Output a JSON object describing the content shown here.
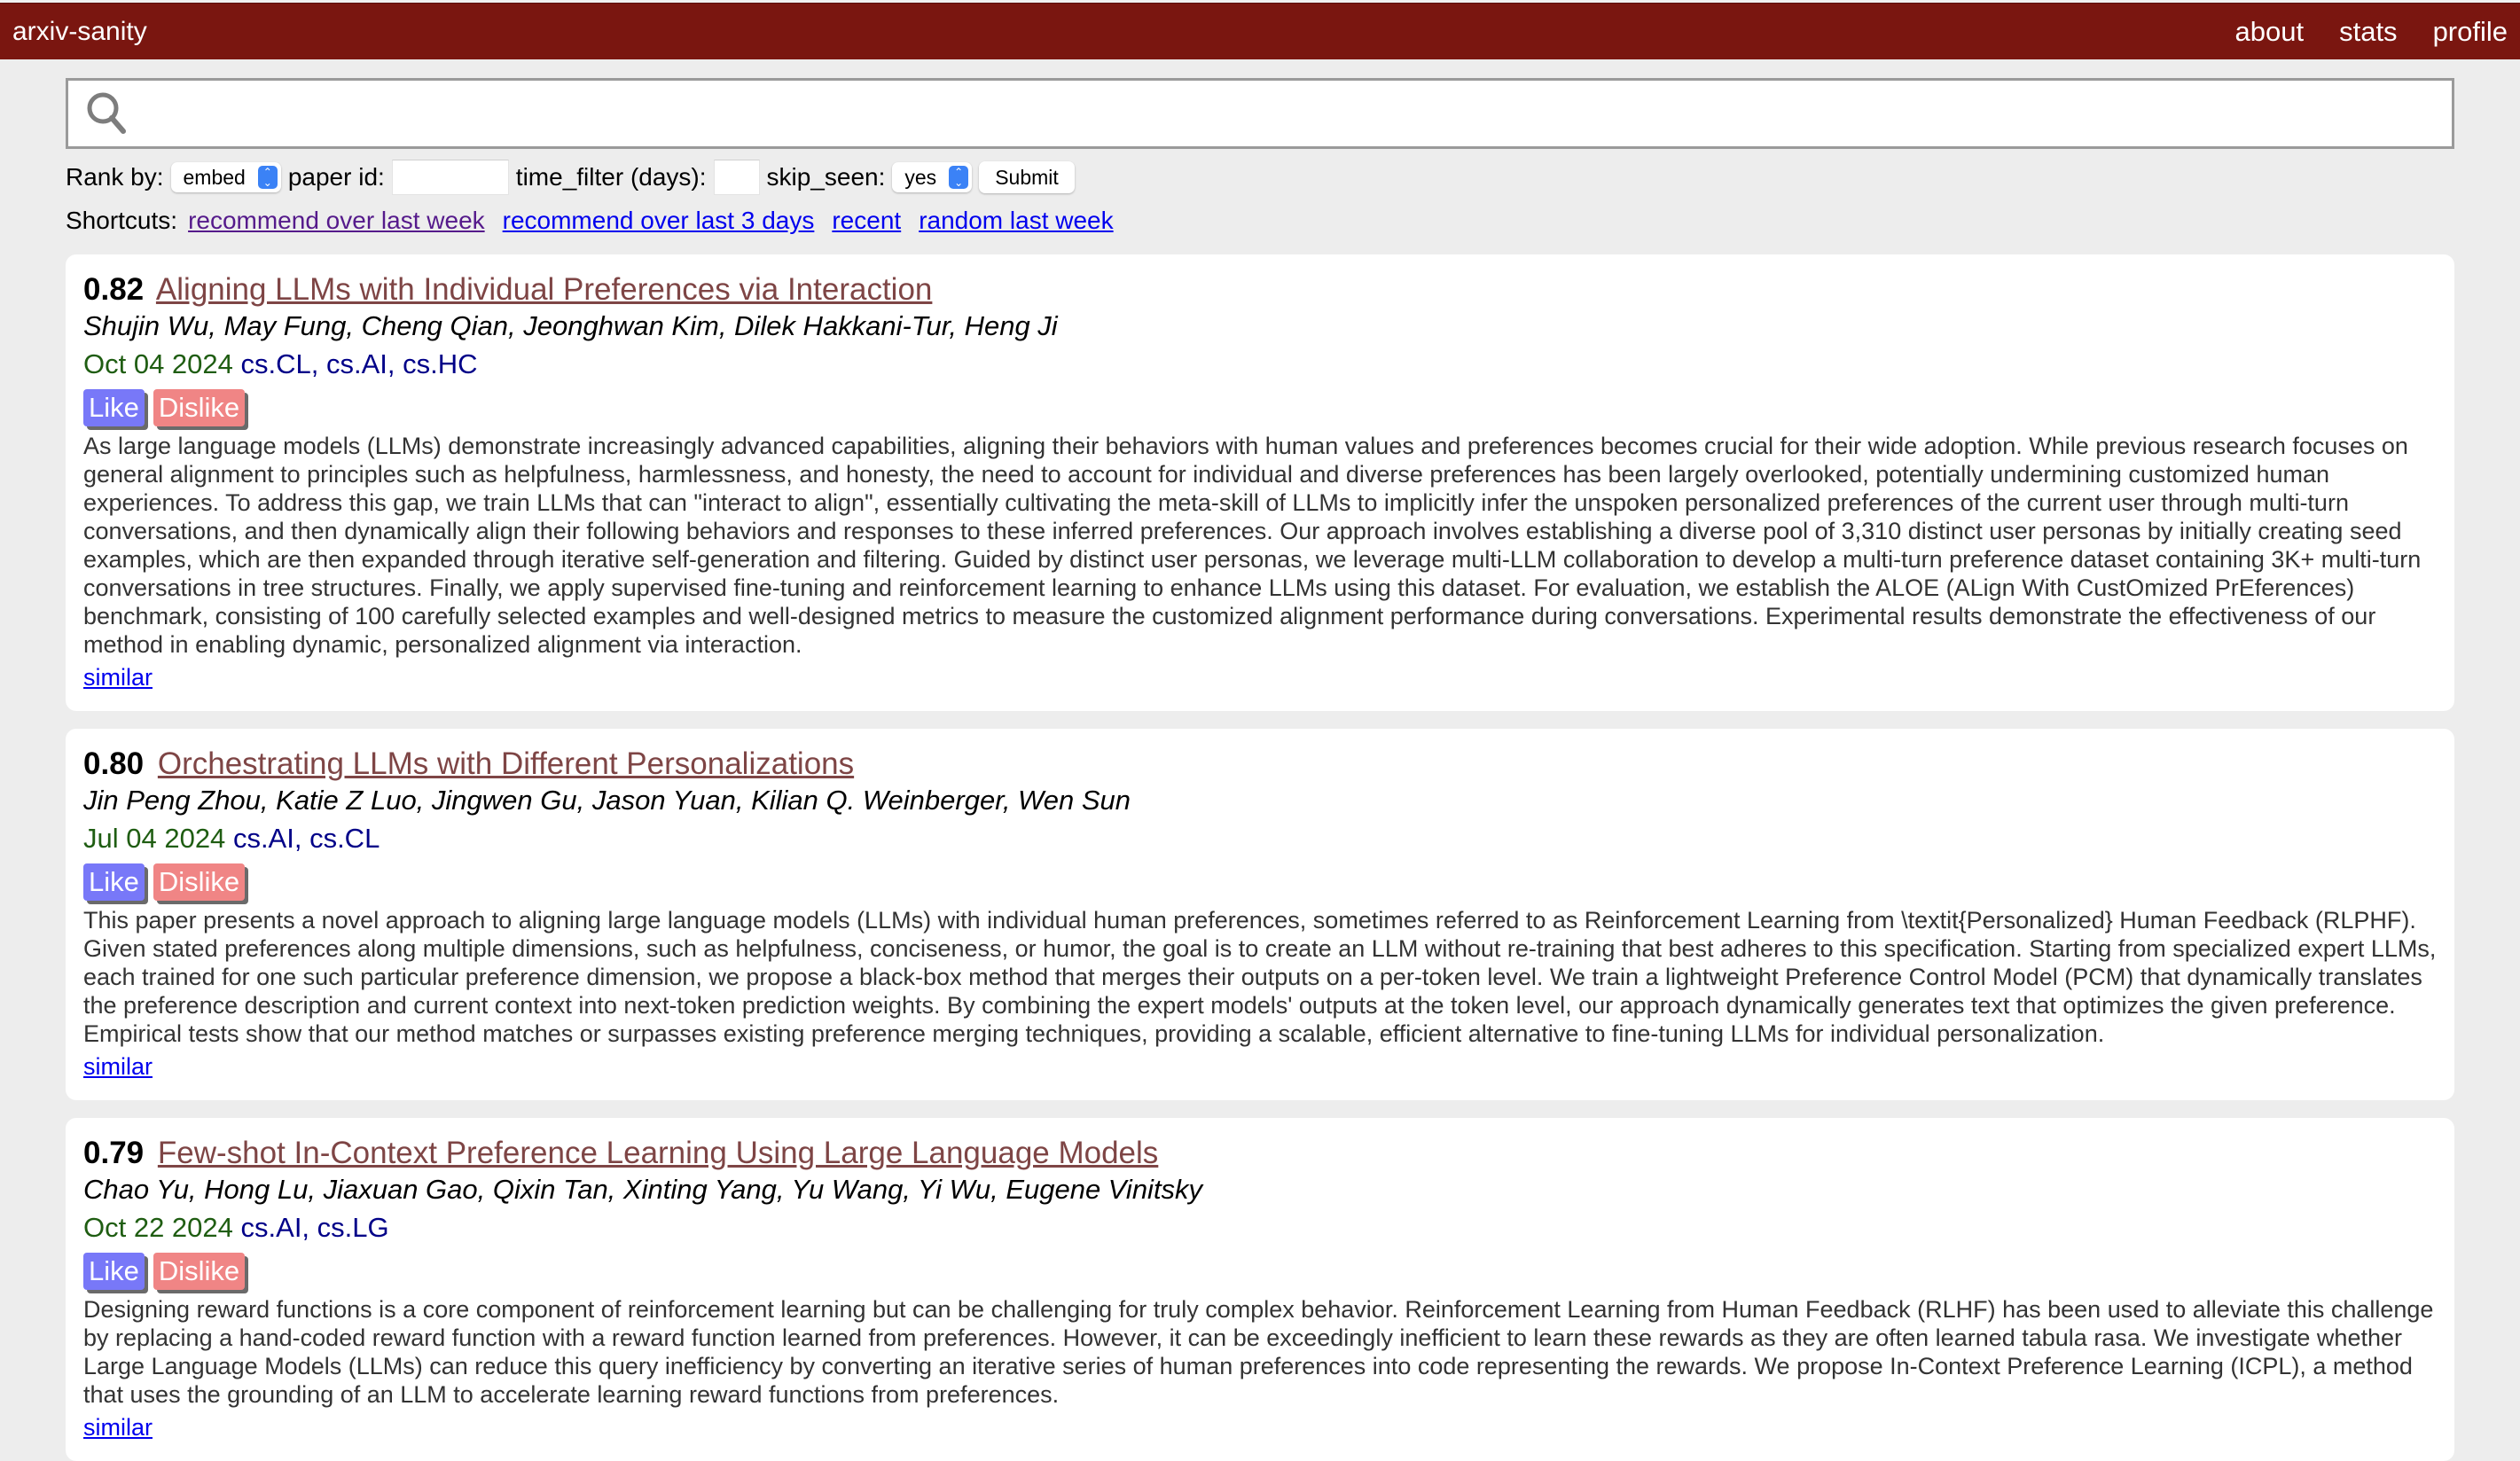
{
  "header": {
    "brand": "arxiv-sanity",
    "nav": [
      "about",
      "stats",
      "profile"
    ]
  },
  "search": {
    "icon": "search-icon",
    "value": "",
    "placeholder": ""
  },
  "controls": {
    "rank_by_label": "Rank by:",
    "rank_by_value": "embed",
    "paper_id_label": "paper id:",
    "paper_id_value": "",
    "time_filter_label": "time_filter (days):",
    "time_filter_value": "",
    "skip_seen_label": "skip_seen:",
    "skip_seen_value": "yes",
    "submit_label": "Submit"
  },
  "shortcuts": {
    "label": "Shortcuts:",
    "links": [
      {
        "label": "recommend over last week",
        "visited": true
      },
      {
        "label": "recommend over last 3 days",
        "visited": false
      },
      {
        "label": "recent",
        "visited": false
      },
      {
        "label": "random last week",
        "visited": false
      }
    ]
  },
  "colors": {
    "header_bg": "#7a1610",
    "title_link": "#7e4545",
    "date": "#1f5d12",
    "tags": "#000088",
    "like": "#7878f8",
    "dislike": "#f08585"
  },
  "papers": [
    {
      "score": "0.82",
      "title": "Aligning LLMs with Individual Preferences via Interaction",
      "authors": "Shujin Wu, May Fung, Cheng Qian, Jeonghwan Kim, Dilek Hakkani-Tur, Heng Ji",
      "date": "Oct 04 2024",
      "tags": "cs.CL, cs.AI, cs.HC",
      "like_label": "Like",
      "dislike_label": "Dislike",
      "abstract": "As large language models (LLMs) demonstrate increasingly advanced capabilities, aligning their behaviors with human values and preferences becomes crucial for their wide adoption. While previous research focuses on general alignment to principles such as helpfulness, harmlessness, and honesty, the need to account for individual and diverse preferences has been largely overlooked, potentially undermining customized human experiences. To address this gap, we train LLMs that can \"interact to align\", essentially cultivating the meta-skill of LLMs to implicitly infer the unspoken personalized preferences of the current user through multi-turn conversations, and then dynamically align their following behaviors and responses to these inferred preferences. Our approach involves establishing a diverse pool of 3,310 distinct user personas by initially creating seed examples, which are then expanded through iterative self-generation and filtering. Guided by distinct user personas, we leverage multi-LLM collaboration to develop a multi-turn preference dataset containing 3K+ multi-turn conversations in tree structures. Finally, we apply supervised fine-tuning and reinforcement learning to enhance LLMs using this dataset. For evaluation, we establish the ALOE (ALign With CustOmized PrEferences) benchmark, consisting of 100 carefully selected examples and well-designed metrics to measure the customized alignment performance during conversations. Experimental results demonstrate the effectiveness of our method in enabling dynamic, personalized alignment via interaction.",
      "similar_label": "similar"
    },
    {
      "score": "0.80",
      "title": "Orchestrating LLMs with Different Personalizations",
      "authors": "Jin Peng Zhou, Katie Z Luo, Jingwen Gu, Jason Yuan, Kilian Q. Weinberger, Wen Sun",
      "date": "Jul 04 2024",
      "tags": "cs.AI, cs.CL",
      "like_label": "Like",
      "dislike_label": "Dislike",
      "abstract": "This paper presents a novel approach to aligning large language models (LLMs) with individual human preferences, sometimes referred to as Reinforcement Learning from \\textit{Personalized} Human Feedback (RLPHF). Given stated preferences along multiple dimensions, such as helpfulness, conciseness, or humor, the goal is to create an LLM without re-training that best adheres to this specification. Starting from specialized expert LLMs, each trained for one such particular preference dimension, we propose a black-box method that merges their outputs on a per-token level. We train a lightweight Preference Control Model (PCM) that dynamically translates the preference description and current context into next-token prediction weights. By combining the expert models' outputs at the token level, our approach dynamically generates text that optimizes the given preference. Empirical tests show that our method matches or surpasses existing preference merging techniques, providing a scalable, efficient alternative to fine-tuning LLMs for individual personalization.",
      "similar_label": "similar"
    },
    {
      "score": "0.79",
      "title": "Few-shot In-Context Preference Learning Using Large Language Models",
      "authors": "Chao Yu, Hong Lu, Jiaxuan Gao, Qixin Tan, Xinting Yang, Yu Wang, Yi Wu, Eugene Vinitsky",
      "date": "Oct 22 2024",
      "tags": "cs.AI, cs.LG",
      "like_label": "Like",
      "dislike_label": "Dislike",
      "abstract": "Designing reward functions is a core component of reinforcement learning but can be challenging for truly complex behavior. Reinforcement Learning from Human Feedback (RLHF) has been used to alleviate this challenge by replacing a hand-coded reward function with a reward function learned from preferences. However, it can be exceedingly inefficient to learn these rewards as they are often learned tabula rasa. We investigate whether Large Language Models (LLMs) can reduce this query inefficiency by converting an iterative series of human preferences into code representing the rewards. We propose In-Context Preference Learning (ICPL), a method that uses the grounding of an LLM to accelerate learning reward functions from preferences.",
      "similar_label": "similar"
    }
  ]
}
